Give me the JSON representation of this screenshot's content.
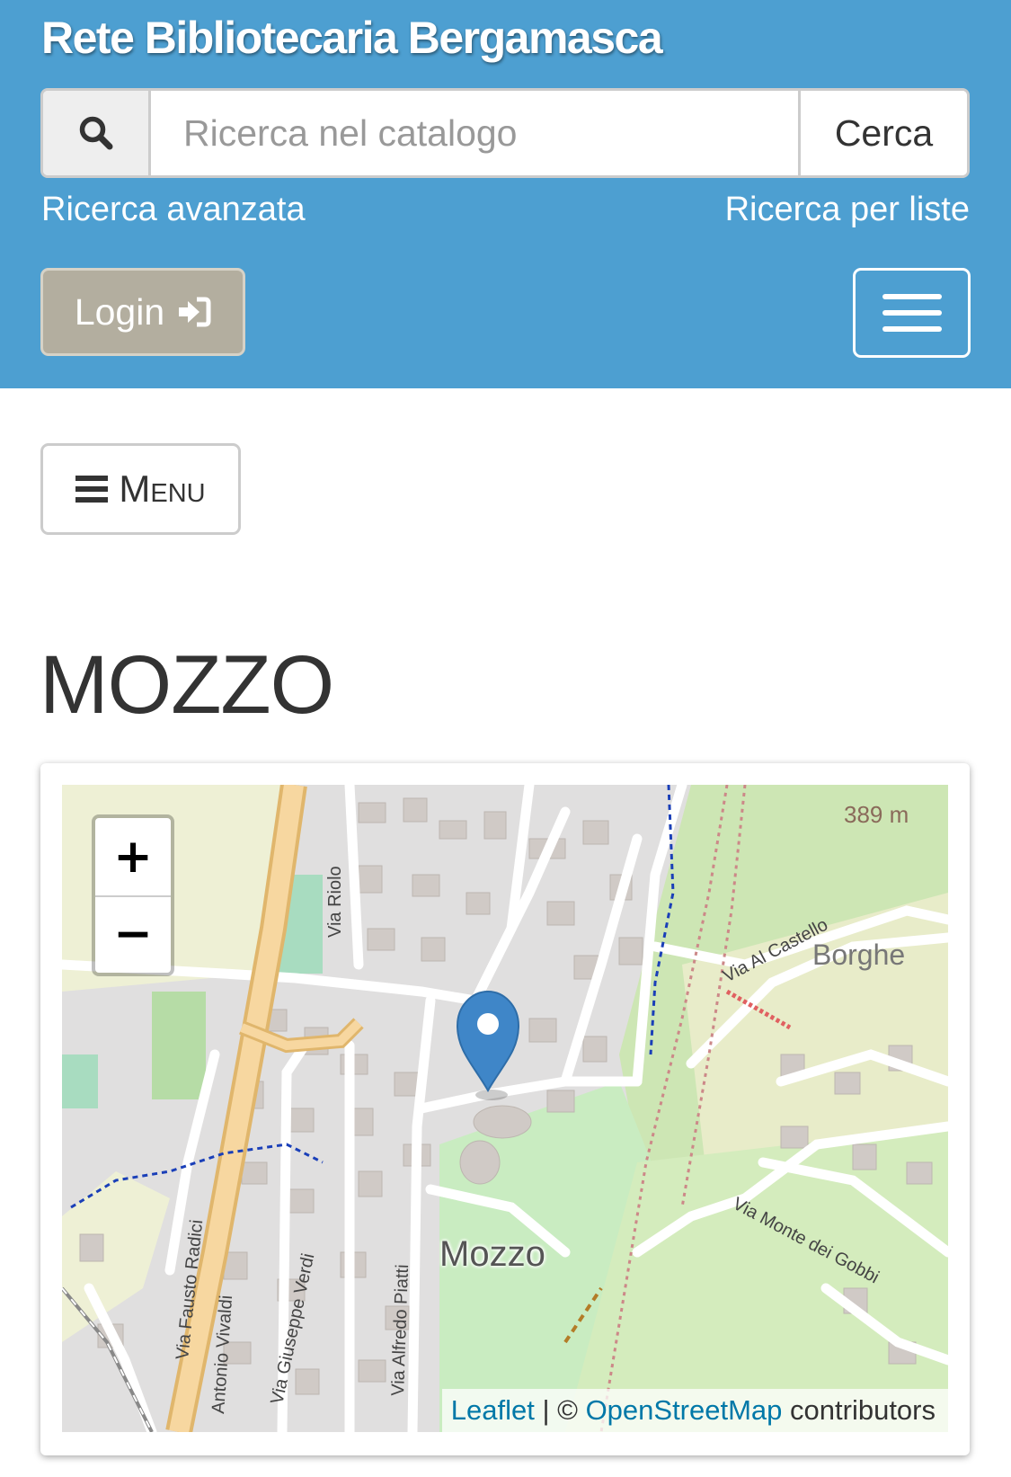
{
  "header": {
    "title": "Rete Bibliotecaria Bergamasca",
    "search": {
      "placeholder": "Ricerca nel catalogo",
      "value": "",
      "button_label": "Cerca"
    },
    "advanced_search_label": "Ricerca avanzata",
    "list_search_label": "Ricerca per liste",
    "login_label": "Login"
  },
  "menu_label": "Menu",
  "page_title": "MOZZO",
  "map": {
    "zoom_in_label": "+",
    "zoom_out_label": "−",
    "place_label": "Mozzo",
    "street_labels": [
      "Via Riolo",
      "Via Al Castello",
      "Borghe",
      "Via Fausto Radici",
      "Via Giuseppe Verdi",
      "Via Alfredo Piatti",
      "Antonio Vivaldi",
      "Via Monte dei Gobbi",
      "389 m"
    ],
    "attribution": {
      "leaflet": "Leaflet",
      "separator": " | © ",
      "osm": "OpenStreetMap",
      "suffix": " contributors"
    },
    "marker_color": "#3f86c8"
  },
  "colors": {
    "header_bg": "#4d9fd1",
    "login_bg": "#b3ae9f"
  }
}
